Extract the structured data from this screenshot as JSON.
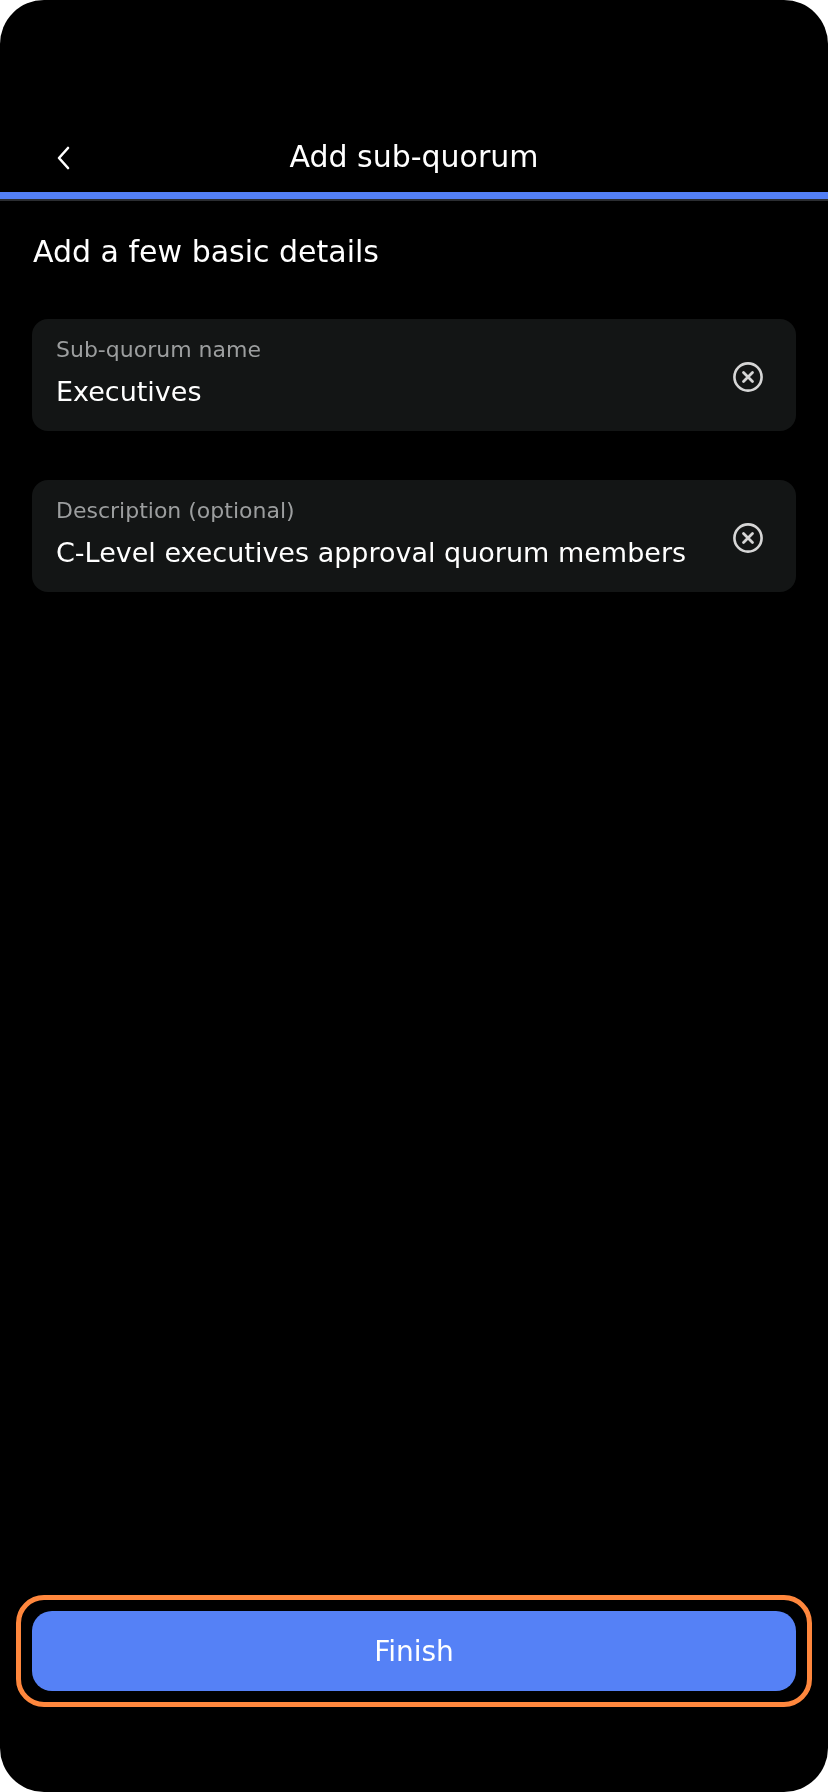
{
  "header": {
    "title": "Add sub-quorum"
  },
  "progress": {
    "level": 1
  },
  "heading": "Add a few basic details",
  "fields": [
    {
      "label": "Sub-quorum name",
      "value": "Executives"
    },
    {
      "label": "Description (optional)",
      "value": "C-Level executives approval quorum members"
    }
  ],
  "finish_button": {
    "label": "Finish",
    "highlighted": true
  }
}
